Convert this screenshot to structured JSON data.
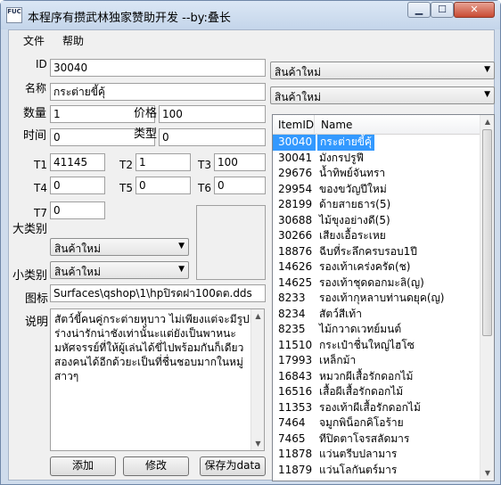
{
  "window": {
    "title": "本程序有攒武林独家赞助开发  --by:叠长",
    "icon_text": "FUC"
  },
  "menu": [
    "文件",
    "帮助"
  ],
  "form": {
    "id_label": "ID",
    "id_value": "30040",
    "name_label": "名称",
    "name_value": "กระต่ายขี้คุ้",
    "qty_label": "数量",
    "qty_value": "1",
    "price_label": "价格",
    "price_value": "100",
    "time_label": "时间",
    "time_value": "0",
    "type_label": "类型",
    "type_value": "0",
    "t1_label": "T1",
    "t1_value": "41145",
    "t2_label": "T2",
    "t2_value": "1",
    "t3_label": "T3",
    "t3_value": "100",
    "t4_label": "T4",
    "t4_value": "0",
    "t5_label": "T5",
    "t5_value": "0",
    "t6_label": "T6",
    "t6_value": "0",
    "t7_label": "T7",
    "t7_value": "0",
    "big_cat_label": "大类别",
    "big_cat_value": "สินค้าใหม่",
    "small_cat_label": "小类别",
    "small_cat_value": "สินค้าใหม่",
    "icon_label": "图标",
    "icon_value": "Surfaces\\qshop\\1\\hpปิรดฝา100ดต.dds",
    "desc_label": "说明",
    "desc_value": "สัตว์ขี้คนคู่กระต่ายหุบาว ไม่เพียงแต่จะมีรูปร่างน่ารักน่าชังเท่านั้นะแต่ยังเป็นพาหนะมหัศจรรย์ที่ให้ผู้เล่นได้ขี่ไปพร้อมกันก็เดียวสองคนได้อีกด้วยะเป็นที่ชื่นชอบมากในหมู่สาวๆ"
  },
  "buttons": {
    "add": "添加",
    "modify": "修改",
    "save": "保存为data"
  },
  "right": {
    "combo1": "สินค้าใหม่",
    "combo2": "สินค้าใหม่",
    "columns": [
      "ItemID",
      "Name"
    ],
    "rows": [
      {
        "id": "30040",
        "name": "กระต่ายขี้คุ้"
      },
      {
        "id": "30041",
        "name": "มังกรปรูฟี"
      },
      {
        "id": "29676",
        "name": "น้ำทิพย์จันทรา"
      },
      {
        "id": "29954",
        "name": "ของขวัญปีใหม่"
      },
      {
        "id": "28199",
        "name": "ด้ายสายธาร(5)"
      },
      {
        "id": "30688",
        "name": "ไม้ขุงอย่างดี(5)"
      },
      {
        "id": "30266",
        "name": "เสียงเอื้อระเหย"
      },
      {
        "id": "18876",
        "name": "ฉีบที่ระลึกครบรอบ1ปี"
      },
      {
        "id": "14626",
        "name": "รองเท้าเคร่งครัด(ช)"
      },
      {
        "id": "14625",
        "name": "รองเท้าชุดดอกมะลิ(ญ)"
      },
      {
        "id": "8233",
        "name": "รองเท้ากุหลาบท่านดยุค(ญ)"
      },
      {
        "id": "8234",
        "name": "สัตว์สีเท้า"
      },
      {
        "id": "8235",
        "name": "ไม้กวาดเวทย์มนต์"
      },
      {
        "id": "11510",
        "name": "กระเป๋าชื่นใหญ่ไฮโซ"
      },
      {
        "id": "17993",
        "name": "เหล็กม้า"
      },
      {
        "id": "16843",
        "name": "หมวกผีเสื้อรักดอกไม้"
      },
      {
        "id": "16516",
        "name": "เสื้อผีเสื้อรักดอกไม้"
      },
      {
        "id": "11353",
        "name": "รองเท้าผีเสื้อรักดอกไม้"
      },
      {
        "id": "7464",
        "name": "จมูกพิน็อกคิโอร้าย"
      },
      {
        "id": "7465",
        "name": "ทีปิดตาโจรสลัดมาร"
      },
      {
        "id": "11878",
        "name": "แว่นตรีบปลามาร"
      },
      {
        "id": "11879",
        "name": "แว่นโลกันตร์มาร"
      }
    ]
  }
}
